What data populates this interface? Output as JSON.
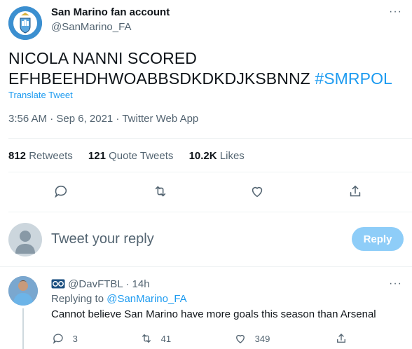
{
  "tweet": {
    "display_name": "San Marino fan account",
    "handle": "@SanMarino_FA",
    "text_line1": "NICOLA NANNI SCORED",
    "text_line2": "EFHBEEHDHWOABBSDKDKDJKSBNNZ",
    "hashtag": "#SMRPOL",
    "translate_label": "Translate Tweet",
    "timestamp": "3:56 AM · Sep 6, 2021 · Twitter Web App",
    "stats": {
      "retweets_count": "812",
      "retweets_label": "Retweets",
      "quote_count": "121",
      "quote_label": "Quote Tweets",
      "likes_count": "10.2K",
      "likes_label": "Likes"
    },
    "actions": [
      "reply-icon",
      "retweet-icon",
      "like-icon",
      "share-icon"
    ]
  },
  "compose": {
    "placeholder": "Tweet your reply",
    "reply_button": "Reply"
  },
  "reply": {
    "handle": "@DavFTBL",
    "time": "· 14h",
    "replying_prefix": "Replying to",
    "replying_to": "@SanMarino_FA",
    "text": "Cannot believe San Marino have more goals this season than Arsenal",
    "reply_count": "3",
    "retweet_count": "41",
    "like_count": "349"
  },
  "colors": {
    "accent": "#1d9bf0",
    "muted": "#536471",
    "reply_button_bg": "#8ecdf8"
  }
}
